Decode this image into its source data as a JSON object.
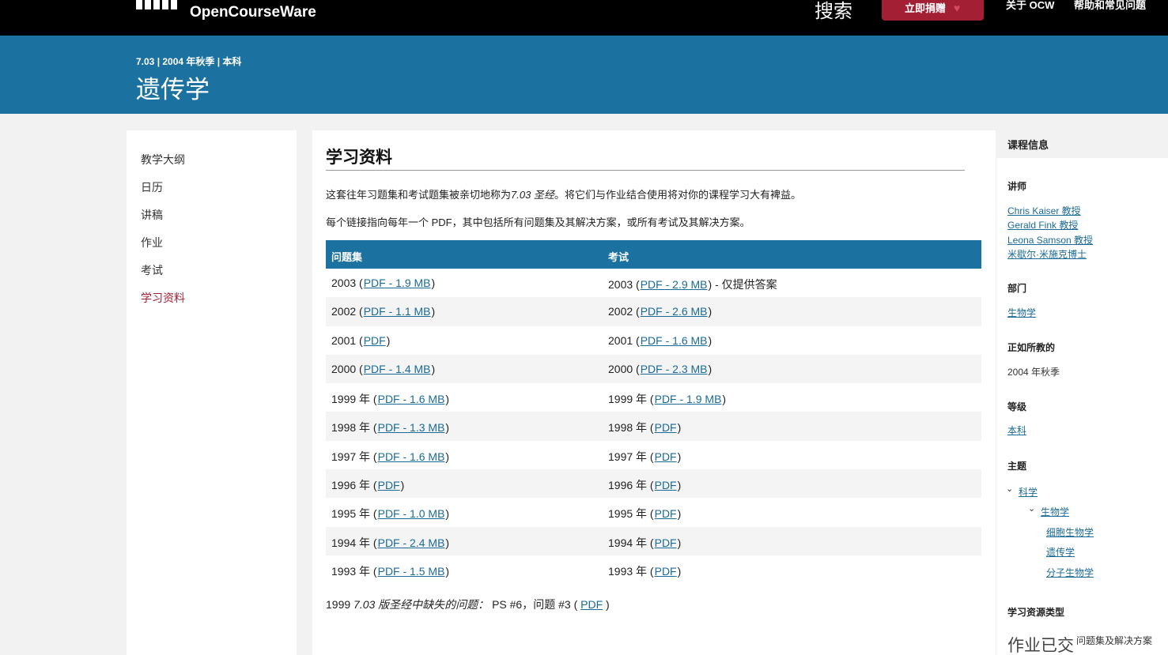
{
  "header": {
    "brand": "OpenCourseWare",
    "search_label": "搜索",
    "donate_label": "立即捐赠",
    "about_label": "关于 OCW",
    "help_label": "帮助和常见问题"
  },
  "course": {
    "subtitle": "7.03 | 2004 年秋季 | 本科",
    "title": "遗传学"
  },
  "nav": [
    {
      "label": "教学大纲"
    },
    {
      "label": "日历"
    },
    {
      "label": "讲稿"
    },
    {
      "label": "作业"
    },
    {
      "label": "考试"
    },
    {
      "label": "学习资料"
    }
  ],
  "main": {
    "title": "学习资料",
    "para1_before": "这套往年习题集和考试题集被亲切地称为",
    "para1_italic": "7.03 圣经",
    "para1_after": "。将它们与作业结合使用将对你的课程学习大有裨益。",
    "para2": "每个链接指向每年一个 PDF，其中包括所有问题集及其解决方案，或所有考试及其解决方案。",
    "table": {
      "headers": [
        "问题集",
        "考试"
      ],
      "rows": [
        {
          "ps_year": "2003",
          "ps_link": "PDF - 1.9 MB",
          "ex_year": "2003",
          "ex_link": "PDF - 2.9 MB",
          "ex_note": " - 仅提供答案"
        },
        {
          "ps_year": "2002",
          "ps_link": "PDF - 1.1 MB",
          "ex_year": "2002",
          "ex_link": "PDF - 2.6 MB",
          "ex_note": ""
        },
        {
          "ps_year": "2001",
          "ps_link": "PDF",
          "ex_year": "2001",
          "ex_link": "PDF - 1.6 MB",
          "ex_note": ""
        },
        {
          "ps_year": "2000",
          "ps_link": "PDF - 1.4 MB",
          "ex_year": "2000",
          "ex_link": "PDF - 2.3 MB",
          "ex_note": ""
        },
        {
          "ps_year": "1999 年",
          "ps_link": "PDF - 1.6 MB",
          "ex_year": "1999 年",
          "ex_link": "PDF - 1.9 MB",
          "ex_note": ""
        },
        {
          "ps_year": "1998 年",
          "ps_link": "PDF - 1.3 MB",
          "ex_year": "1998 年",
          "ex_link": "PDF",
          "ex_note": ""
        },
        {
          "ps_year": "1997 年",
          "ps_link": "PDF - 1.6 MB",
          "ex_year": "1997 年",
          "ex_link": "PDF",
          "ex_note": ""
        },
        {
          "ps_year": "1996 年",
          "ps_link": "PDF",
          "ex_year": "1996 年",
          "ex_link": "PDF",
          "ex_note": ""
        },
        {
          "ps_year": "1995 年",
          "ps_link": "PDF - 1.0 MB",
          "ex_year": "1995 年",
          "ex_link": "PDF",
          "ex_note": ""
        },
        {
          "ps_year": "1994 年",
          "ps_link": "PDF - 2.4 MB",
          "ex_year": "1994 年",
          "ex_link": "PDF",
          "ex_note": ""
        },
        {
          "ps_year": "1993 年",
          "ps_link": "PDF - 1.5 MB",
          "ex_year": "1993 年",
          "ex_link": "PDF",
          "ex_note": ""
        }
      ]
    },
    "footnote_before": "1999 ",
    "footnote_italic": "7.03 版圣经中缺失的问题：",
    "footnote_after": " PS #6，问题 #3 (",
    "footnote_link": "PDF",
    "footnote_end": ")"
  },
  "sidebar": {
    "title": "课程信息",
    "instructors_head": "讲师",
    "instructors": [
      "Chris Kaiser 教授",
      "Gerald Fink 教授",
      "Leona Samson 教授",
      "米歇尔·米施克博士"
    ],
    "dept_head": "部门",
    "dept": "生物学",
    "as_taught_head": "正如所教的",
    "as_taught": "2004 年秋季",
    "level_head": "等级",
    "level": "本科",
    "topics_head": "主题",
    "topics": {
      "l1": "科学",
      "l2": "生物学",
      "l3": [
        "细胞生物学",
        "遗传学",
        "分子生物学"
      ]
    },
    "resource_head": "学习资源类型",
    "resource_big": "作业已交",
    "resource_small": "问题集及解决方案"
  }
}
